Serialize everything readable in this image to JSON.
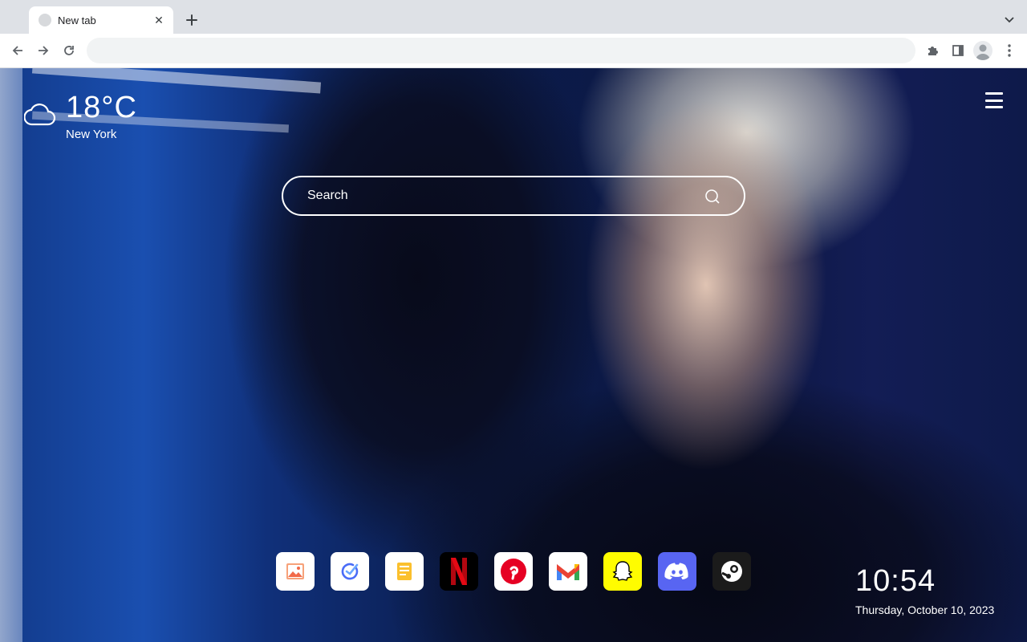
{
  "browser": {
    "tab": {
      "title": "New tab",
      "close_glyph": "✕"
    },
    "new_tab_glyph": "+",
    "omnibox": {
      "value": "",
      "placeholder": ""
    }
  },
  "weather": {
    "temperature": "18°C",
    "city": "New York",
    "icon": "cloud-icon"
  },
  "search": {
    "placeholder": "Search"
  },
  "shortcuts": [
    {
      "name": "photos",
      "icon": "image-icon",
      "bg": "#ffffff"
    },
    {
      "name": "tasks",
      "icon": "check-circle-icon",
      "bg": "#ffffff"
    },
    {
      "name": "notes",
      "icon": "notes-icon",
      "bg": "#ffffff"
    },
    {
      "name": "netflix",
      "icon": "netflix-icon",
      "glyph": "N",
      "bg": "#000000",
      "accent": "#e50914"
    },
    {
      "name": "pinterest",
      "icon": "pinterest-icon",
      "bg": "#ffffff",
      "accent": "#e60023"
    },
    {
      "name": "gmail",
      "icon": "gmail-icon",
      "bg": "#ffffff"
    },
    {
      "name": "snapchat",
      "icon": "snapchat-icon",
      "bg": "#fffc00"
    },
    {
      "name": "discord",
      "icon": "discord-icon",
      "bg": "#5865f2"
    },
    {
      "name": "steam",
      "icon": "steam-icon",
      "bg": "#1b1b1b"
    }
  ],
  "clock": {
    "time": "10:54",
    "date": "Thursday, October 10, 2023"
  },
  "colors": {
    "tabstrip": "#dee1e6",
    "toolbar": "#ffffff",
    "omnibox": "#f1f3f4",
    "overlay_text": "#ffffff"
  }
}
